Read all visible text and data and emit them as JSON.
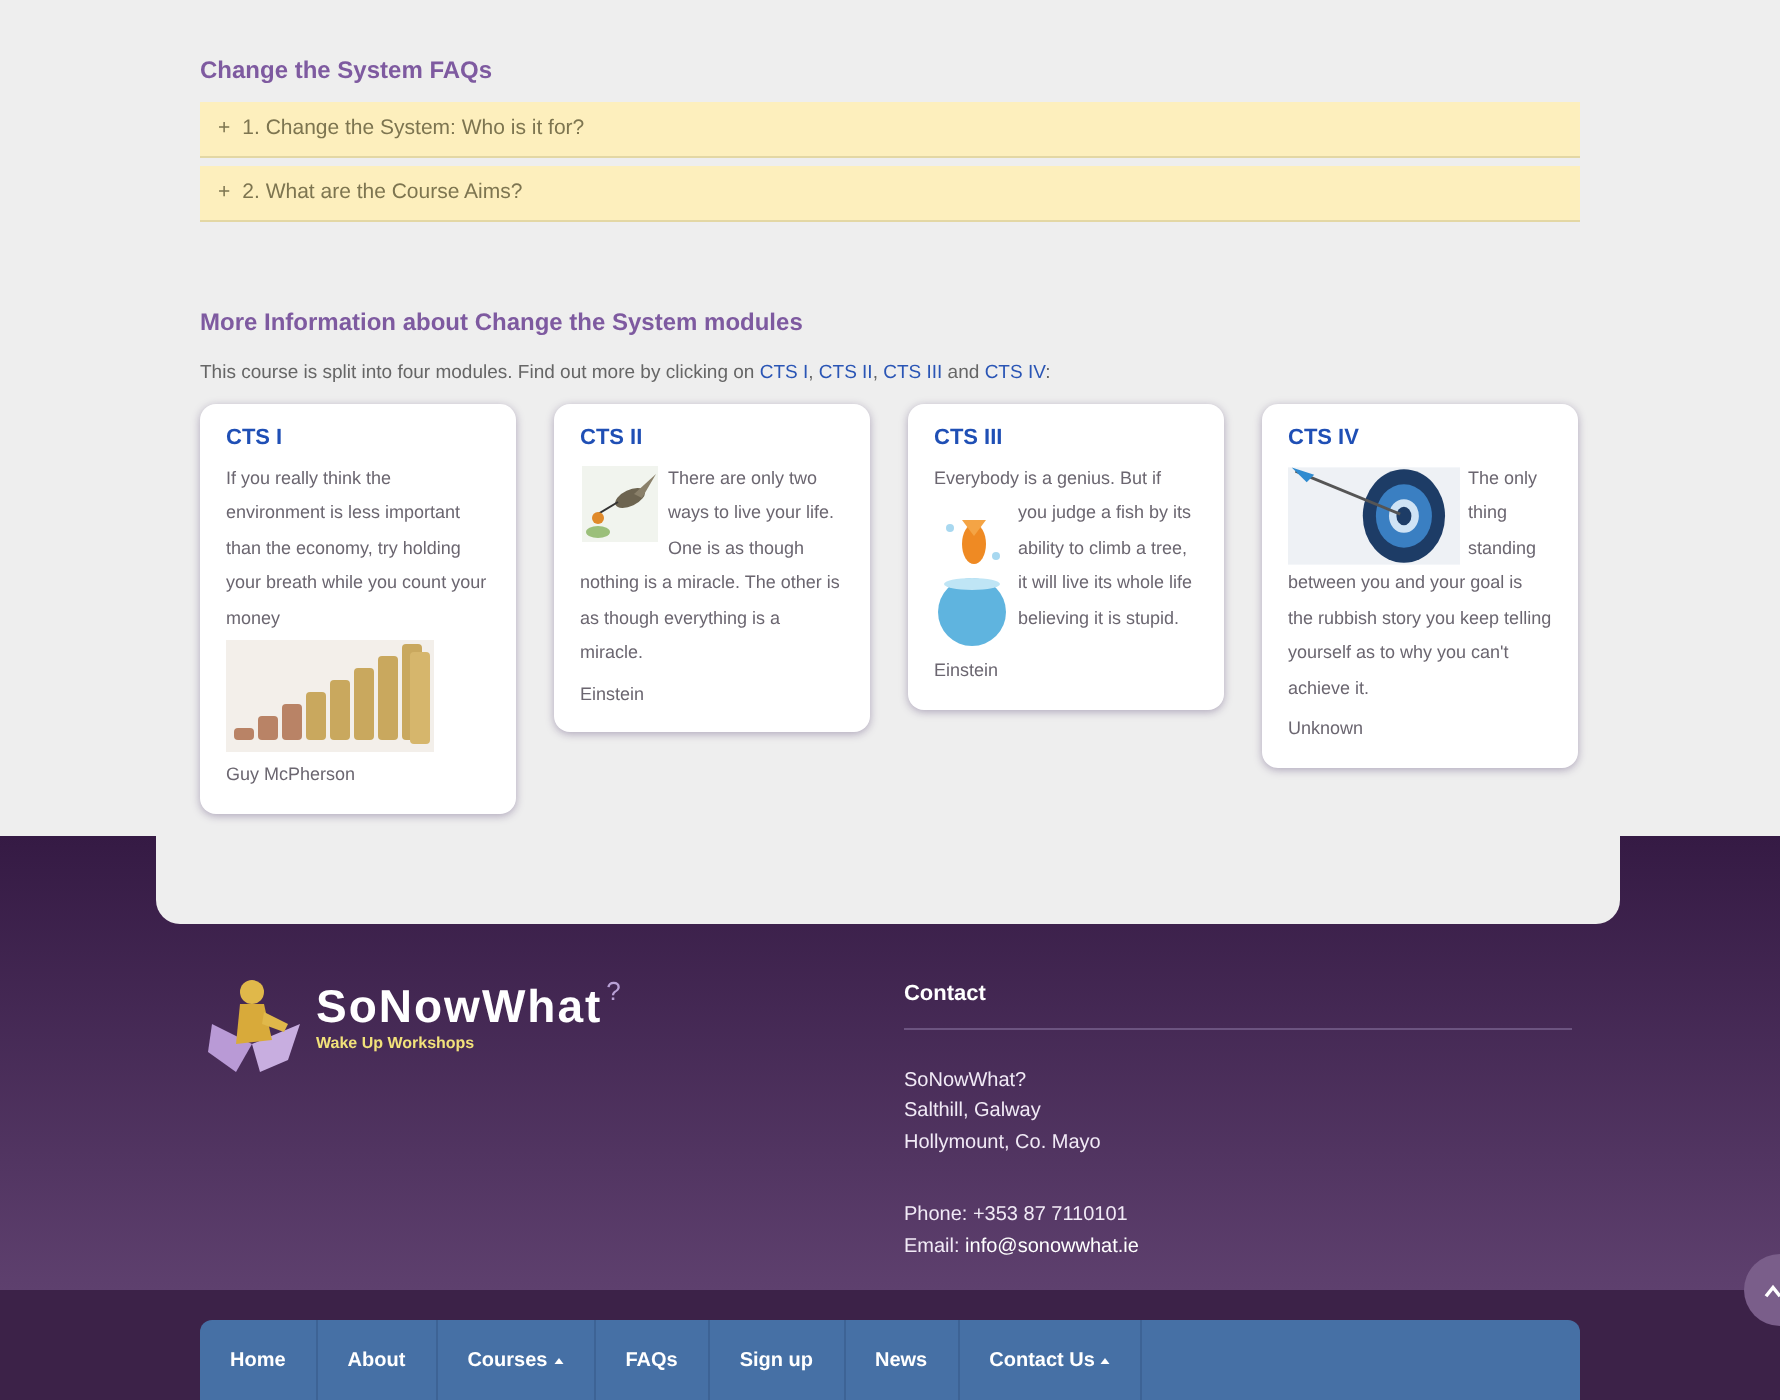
{
  "faq": {
    "title": "Change the System FAQs",
    "items": [
      {
        "icon": "+",
        "label": "1. Change the System: Who is it for?",
        "expanded": false
      },
      {
        "icon": "+",
        "label": "2. What are the Course Aims?",
        "expanded": false
      }
    ]
  },
  "modules": {
    "title": "More Information about Change the System modules",
    "intro": [
      {
        "kind": "text",
        "text": "This course is split into four modules. Find out more by clicking on "
      },
      {
        "kind": "link",
        "text": "CTS I"
      },
      {
        "kind": "text",
        "text": ", "
      },
      {
        "kind": "link",
        "text": "CTS II"
      },
      {
        "kind": "text",
        "text": ", "
      },
      {
        "kind": "link",
        "text": "CTS III"
      },
      {
        "kind": "text",
        "text": " and "
      },
      {
        "kind": "link",
        "text": "CTS IV"
      },
      {
        "kind": "text",
        "text": ":"
      }
    ],
    "cards": [
      {
        "title": "CTS I",
        "kind": "below",
        "quote": "If you really think the environment is less important than the economy, try holding your breath while you count your money",
        "author": "Guy McPherson"
      },
      {
        "title": "CTS II",
        "kind": "beside",
        "quote_side": "There are only two ways to live your life. One is as though",
        "quote": "nothing is a miracle. The other is as though everything is a miracle.",
        "author": "Einstein"
      },
      {
        "title": "CTS III",
        "kind": "beside",
        "lead": "Everybody is a genius.  But if",
        "quote_side": "you judge a  fish by its ability to climb a tree, it will live its whole life believing it is stupid.",
        "author": "Einstein"
      },
      {
        "title": "CTS IV",
        "kind": "beside",
        "quote_side": "The only thing standing",
        "quote": "between you and your goal is the rubbish story you keep telling yourself as to why you can't achieve it.",
        "author": "Unknown"
      }
    ]
  },
  "footer": {
    "logo": {
      "name": "SoNowWhat",
      "mark": "?",
      "tagline": "Wake Up Workshops"
    },
    "contact": {
      "title": "Contact",
      "address": [
        "SoNowWhat?",
        "Salthill, Galway",
        "Hollymount, Co. Mayo"
      ],
      "phone": "Phone: +353 87 7110101",
      "email_label": "Email: ",
      "email": "info@sonowwhat.ie"
    }
  },
  "nav": [
    {
      "label": "Home",
      "caret": false
    },
    {
      "label": "About",
      "caret": false
    },
    {
      "label": "Courses",
      "caret": true
    },
    {
      "label": "FAQs",
      "caret": false
    },
    {
      "label": "Sign up",
      "caret": false
    },
    {
      "label": "News",
      "caret": false
    },
    {
      "label": "Contact Us",
      "caret": true
    }
  ]
}
